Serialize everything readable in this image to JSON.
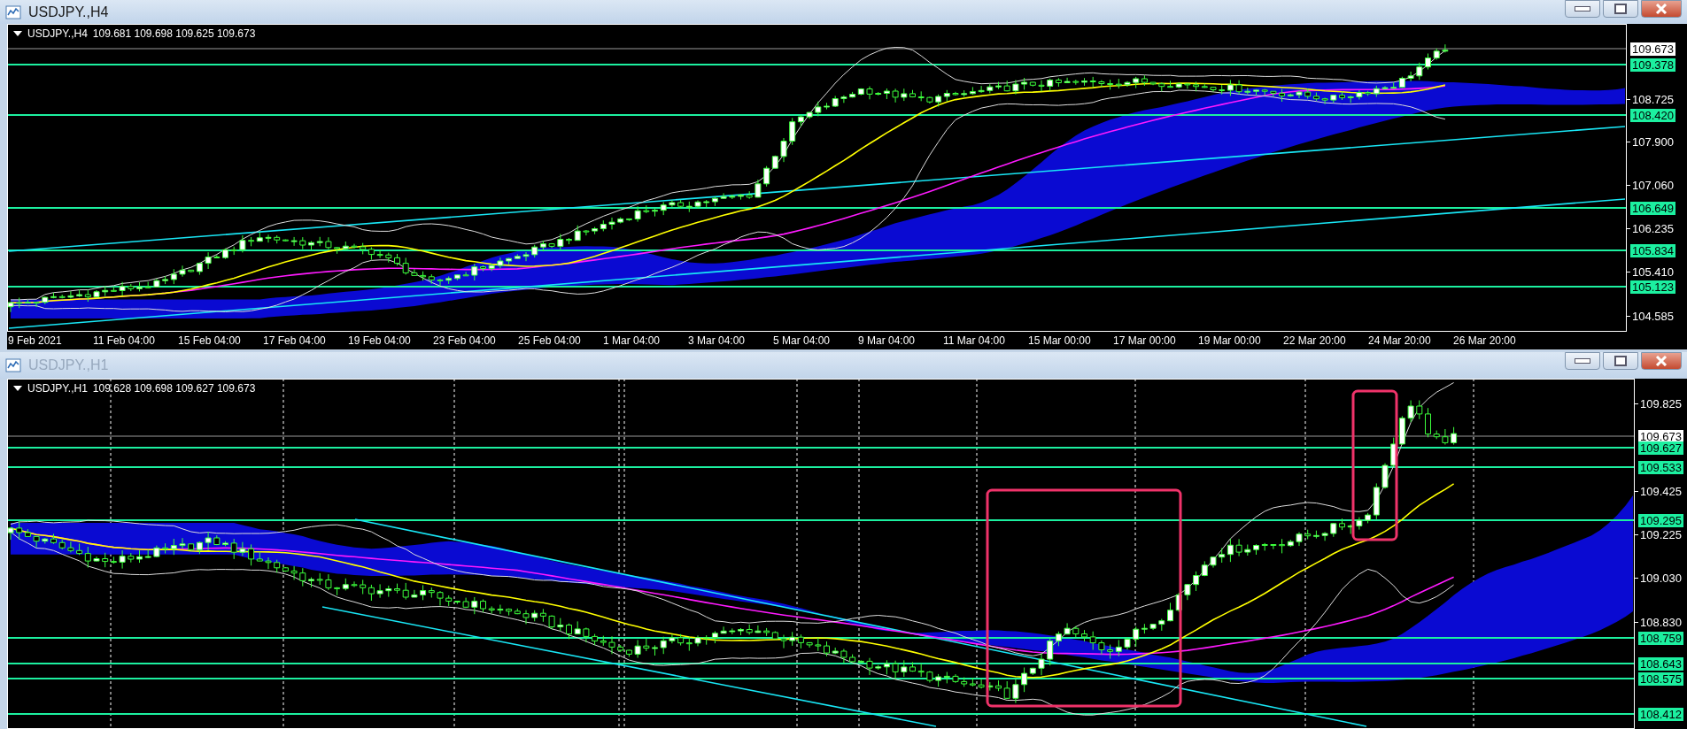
{
  "windows": [
    {
      "title": "USDJPY.,H4",
      "active": true,
      "chart": {
        "symbol": "USDJPY.,H4",
        "ohlc": "109.681 109.698 109.625 109.673",
        "price_axis": [
          {
            "label": "109.673",
            "kind": "current"
          },
          {
            "label": "109.378",
            "kind": "level"
          },
          {
            "label": "108.725",
            "kind": "tick"
          },
          {
            "label": "108.420",
            "kind": "level"
          },
          {
            "label": "107.900",
            "kind": "tick"
          },
          {
            "label": "107.060",
            "kind": "tick"
          },
          {
            "label": "106.649",
            "kind": "level"
          },
          {
            "label": "106.235",
            "kind": "tick"
          },
          {
            "label": "105.834",
            "kind": "level"
          },
          {
            "label": "105.410",
            "kind": "tick"
          },
          {
            "label": "105.123",
            "kind": "level"
          },
          {
            "label": "104.585",
            "kind": "tick"
          }
        ],
        "time_axis": [
          "9 Feb 2021",
          "11 Feb 04:00",
          "15 Feb 04:00",
          "17 Feb 04:00",
          "19 Feb 04:00",
          "23 Feb 04:00",
          "25 Feb 04:00",
          "1 Mar 04:00",
          "3 Mar 04:00",
          "5 Mar 04:00",
          "9 Mar 04:00",
          "11 Mar 04:00",
          "15 Mar 00:00",
          "17 Mar 00:00",
          "19 Mar 00:00",
          "22 Mar 20:00",
          "24 Mar 20:00",
          "26 Mar 20:00"
        ]
      }
    },
    {
      "title": "USDJPY.,H1",
      "active": false,
      "chart": {
        "symbol": "USDJPY.,H1",
        "ohlc": "109.628 109.698 109.627 109.673",
        "price_axis": [
          {
            "label": "109.825",
            "kind": "tick"
          },
          {
            "label": "109.673",
            "kind": "current"
          },
          {
            "label": "109.627",
            "kind": "level"
          },
          {
            "label": "109.533",
            "kind": "level"
          },
          {
            "label": "109.425",
            "kind": "tick"
          },
          {
            "label": "109.295",
            "kind": "level"
          },
          {
            "label": "109.225",
            "kind": "tick"
          },
          {
            "label": "109.030",
            "kind": "tick"
          },
          {
            "label": "108.830",
            "kind": "tick"
          },
          {
            "label": "108.759",
            "kind": "level"
          },
          {
            "label": "108.643",
            "kind": "level"
          },
          {
            "label": "108.575",
            "kind": "level"
          },
          {
            "label": "108.412",
            "kind": "level"
          }
        ]
      }
    }
  ]
}
